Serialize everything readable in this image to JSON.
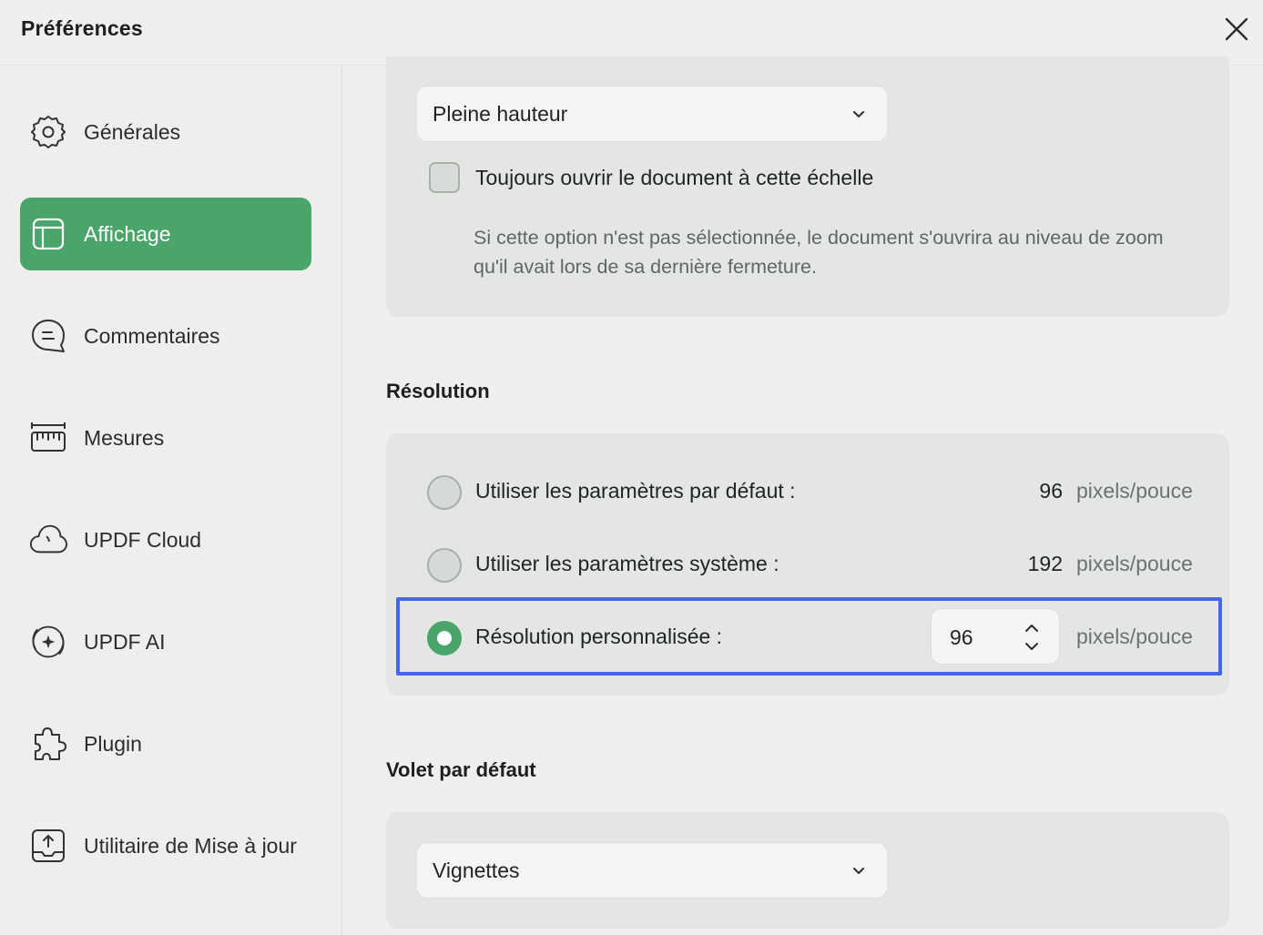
{
  "header": {
    "title": "Préférences"
  },
  "sidebar": {
    "items": [
      {
        "label": "Générales",
        "icon": "gear-icon"
      },
      {
        "label": "Affichage",
        "icon": "layout-icon",
        "active": true
      },
      {
        "label": "Commentaires",
        "icon": "comment-icon"
      },
      {
        "label": "Mesures",
        "icon": "ruler-icon"
      },
      {
        "label": "UPDF Cloud",
        "icon": "cloud-icon"
      },
      {
        "label": "UPDF AI",
        "icon": "ai-icon"
      },
      {
        "label": "Plugin",
        "icon": "puzzle-icon"
      },
      {
        "label": "Utilitaire de Mise à jour",
        "icon": "update-icon"
      }
    ]
  },
  "zoom": {
    "select_value": "Pleine hauteur",
    "checkbox_label": "Toujours ouvrir le document à cette échelle",
    "checkbox_checked": false,
    "hint": "Si cette option n'est pas sélectionnée, le document s'ouvrira au niveau de zoom qu'il avait lors de sa dernière fermeture."
  },
  "resolution": {
    "title": "Résolution",
    "options": [
      {
        "label": "Utiliser les paramètres par défaut :",
        "value": "96",
        "unit": "pixels/pouce",
        "checked": false
      },
      {
        "label": "Utiliser les paramètres système :",
        "value": "192",
        "unit": "pixels/pouce",
        "checked": false
      },
      {
        "label": "Résolution personnalisée :",
        "value": "96",
        "unit": "pixels/pouce",
        "checked": true
      }
    ]
  },
  "volet": {
    "title": "Volet par défaut",
    "select_value": "Vignettes"
  },
  "colors": {
    "accent": "#4aa56a",
    "highlight": "#4466e8"
  }
}
